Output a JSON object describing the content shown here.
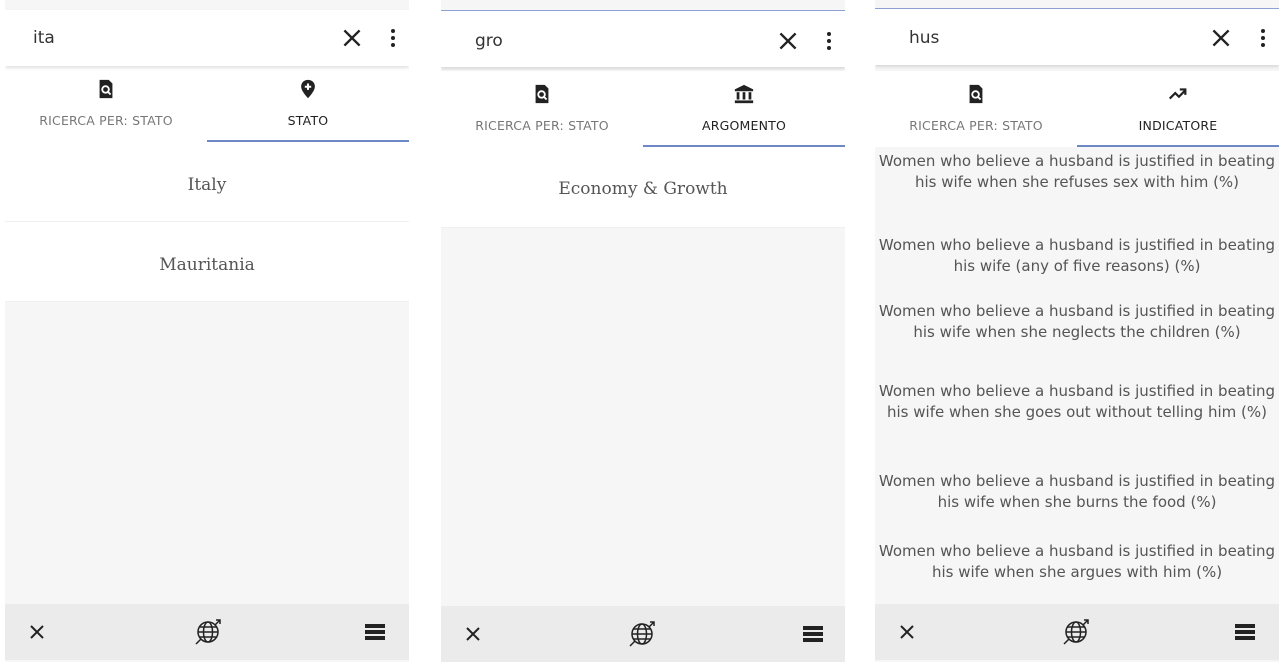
{
  "panels": [
    {
      "query": "ita",
      "tabs": [
        {
          "label": "RICERCA PER: STATO",
          "icon": "search-document-icon"
        },
        {
          "label": "STATO",
          "icon": "location-plus-icon"
        }
      ],
      "results": [
        "Italy",
        "Mauritania"
      ]
    },
    {
      "query": "gro",
      "tabs": [
        {
          "label": "RICERCA PER: STATO",
          "icon": "search-document-icon"
        },
        {
          "label": "ARGOMENTO",
          "icon": "bank-icon"
        }
      ],
      "results": [
        "Economy & Growth"
      ]
    },
    {
      "query": "hus",
      "tabs": [
        {
          "label": "RICERCA PER: STATO",
          "icon": "search-document-icon"
        },
        {
          "label": "INDICATORE",
          "icon": "trending-up-icon"
        }
      ],
      "results": [
        "Women who believe a husband is justified in beating his wife when she refuses sex with him (%)",
        "Women who believe a husband is justified in beating his wife (any of five reasons) (%)",
        "Women who believe a husband is justified in beating his wife when she neglects the children (%)",
        "Women who believe a husband is justified in beating his wife when she goes out without telling him (%)",
        "Women who believe a husband is justified in beating his wife when she burns the food (%)",
        "Women who believe a husband is justified in beating his wife when she argues with him (%)"
      ]
    }
  ],
  "bottom_bar": {
    "icons": [
      "close-icon",
      "globe-icon",
      "list-menu-icon"
    ]
  },
  "colors": {
    "accent_underline": "#6d88c4",
    "background": "#f6f6f6",
    "bottom_bar": "#ebebeb"
  }
}
